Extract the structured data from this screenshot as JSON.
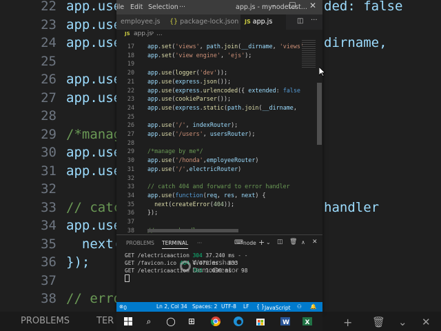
{
  "background": {
    "lines": [
      {
        "ln": "22",
        "code": "app.use",
        "right": "ded: false"
      },
      {
        "ln": "23",
        "code": "app.use",
        "right": ""
      },
      {
        "ln": "24",
        "code": "app.use",
        "right": "dirname,"
      },
      {
        "ln": "25",
        "code": "",
        "right": ""
      },
      {
        "ln": "26",
        "code": "app.use",
        "right": ""
      },
      {
        "ln": "27",
        "code": "app.use",
        "right": ""
      },
      {
        "ln": "28",
        "code": "",
        "right": ""
      },
      {
        "ln": "29",
        "code": "/*manag",
        "right": ""
      },
      {
        "ln": "30",
        "code": "app.use",
        "right": ""
      },
      {
        "ln": "31",
        "code": "app.use",
        "right": ""
      },
      {
        "ln": "32",
        "code": "",
        "right": ""
      },
      {
        "ln": "33",
        "code": "// catc",
        "right": "handler"
      },
      {
        "ln": "34",
        "code": "app.use",
        "right": ""
      },
      {
        "ln": "35",
        "code": "  next(",
        "right": ""
      },
      {
        "ln": "36",
        "code": "});",
        "right": ""
      },
      {
        "ln": "37",
        "code": "",
        "right": ""
      },
      {
        "ln": "38",
        "code": "// erro",
        "right": ""
      }
    ],
    "bottom_left": "PROBLEMS",
    "bottom_left2": "TER"
  },
  "titlebar": {
    "menu": [
      "ile",
      "Edit",
      "Selection",
      "···"
    ],
    "title": "app.js - mynodetest..."
  },
  "tabs": [
    {
      "icon": "",
      "label": "employee.js",
      "active": false
    },
    {
      "icon": "{}",
      "label": "package-lock.json",
      "active": false
    },
    {
      "icon": "JS",
      "label": "app.js",
      "active": true
    }
  ],
  "breadcrumb": {
    "icon": "JS",
    "file": "app.js",
    "more": "..."
  },
  "code_lines": [
    {
      "ln": "17",
      "html": "<span class='k'>app</span>.<span class='f'>set</span>(<span class='s'>'views'</span>, <span class='k'>path</span>.<span class='f'>join</span>(<span class='k'>__dirname</span>, <span class='s'>'views'</span>"
    },
    {
      "ln": "18",
      "html": "<span class='k'>app</span>.<span class='f'>set</span>(<span class='s'>'view engine'</span>, <span class='s'>'ejs'</span>);"
    },
    {
      "ln": "19",
      "html": ""
    },
    {
      "ln": "20",
      "html": "<span class='k'>app</span>.<span class='f'>use</span>(<span class='f'>logger</span>(<span class='s'>'dev'</span>));"
    },
    {
      "ln": "21",
      "html": "<span class='k'>app</span>.<span class='f'>use</span>(<span class='k'>express</span>.<span class='f'>json</span>());"
    },
    {
      "ln": "22",
      "html": "<span class='k'>app</span>.<span class='f'>use</span>(<span class='k'>express</span>.<span class='f'>urlencoded</span>({ <span class='k'>extended</span>: <span class='kw'>false</span>"
    },
    {
      "ln": "23",
      "html": "<span class='k'>app</span>.<span class='f'>use</span>(<span class='f'>cookieParser</span>());"
    },
    {
      "ln": "24",
      "html": "<span class='k'>app</span>.<span class='f'>use</span>(<span class='k'>express</span>.<span class='f'>static</span>(<span class='k'>path</span>.<span class='f'>join</span>(<span class='k'>__dirname</span>,"
    },
    {
      "ln": "25",
      "html": ""
    },
    {
      "ln": "26",
      "html": "<span class='k'>app</span>.<span class='f'>use</span>(<span class='s'>'/'</span>, <span class='k'>indexRouter</span>);"
    },
    {
      "ln": "27",
      "html": "<span class='k'>app</span>.<span class='f'>use</span>(<span class='s'>'/users'</span>, <span class='k'>usersRouter</span>);"
    },
    {
      "ln": "28",
      "html": ""
    },
    {
      "ln": "29",
      "html": "<span class='c'>/*manage by me*/</span>"
    },
    {
      "ln": "30",
      "html": "<span class='k'>app</span>.<span class='f'>use</span>(<span class='s'>'/honda'</span>,<span class='k'>employeeRouter</span>)"
    },
    {
      "ln": "31",
      "html": "<span class='k'>app</span>.<span class='f'>use</span>(<span class='s'>'/'</span>,<span class='k'>electricRouter</span>)"
    },
    {
      "ln": "32",
      "html": ""
    },
    {
      "ln": "33",
      "html": "<span class='c'>// catch 404 and forward to error handler</span>"
    },
    {
      "ln": "34",
      "html": "<span class='k'>app</span>.<span class='f'>use</span>(<span class='kw'>function</span>(<span class='k'>req</span>, <span class='k'>res</span>, <span class='k'>next</span>) {"
    },
    {
      "ln": "35",
      "html": "  <span class='f'>next</span>(<span class='f'>createError</span>(<span class='n'>404</span>));"
    },
    {
      "ln": "36",
      "html": "});"
    },
    {
      "ln": "37",
      "html": ""
    },
    {
      "ln": "38",
      "html": "<span class='c'>// error handler</span>"
    }
  ],
  "panel": {
    "tabs": [
      "PROBLEMS",
      "TERMINAL",
      "···"
    ],
    "shell": "node",
    "terminal_lines": [
      {
        "pre": "GET /electricaaction ",
        "code": "304",
        "post": " 37.240 ms - -"
      },
      {
        "pre": "GET /favicon.ico ",
        "code": "404",
        "post": " 4.470 ms - 833"
      },
      {
        "pre": "GET /electricaaction ",
        "code": "304",
        "post": " 1.096 ms - 98"
      }
    ],
    "watermark": [
      "Wondershare",
      "DemoCreator"
    ]
  },
  "statusbar": {
    "errors": "0",
    "position": "Ln 2, Col 34",
    "spaces": "Spaces: 2",
    "encoding": "UTF-8",
    "eol": "LF",
    "language": "JavaScript"
  },
  "colors": {
    "accent": "#007acc",
    "titlebar": "#3c3c3c",
    "editor_bg": "#1e1e1e"
  }
}
